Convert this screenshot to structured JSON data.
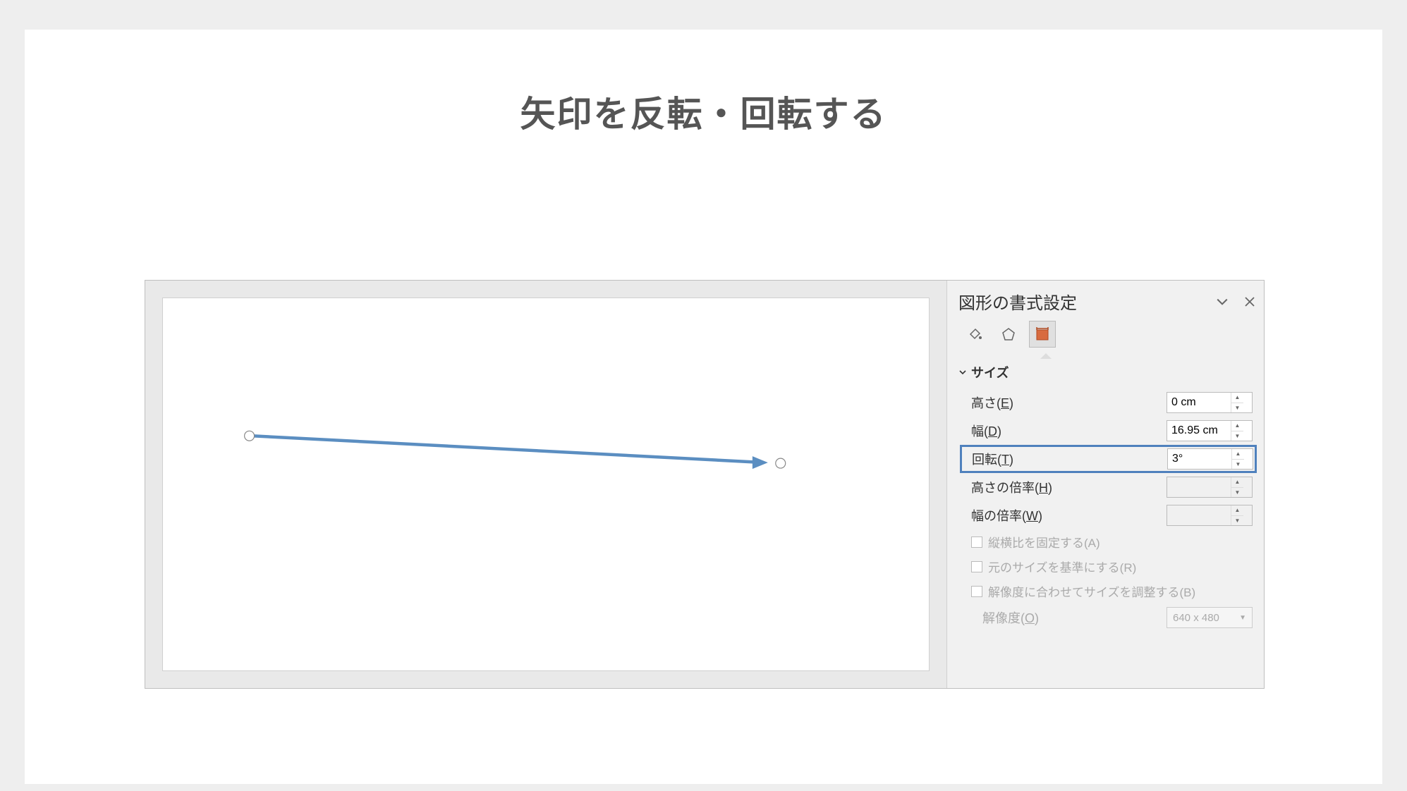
{
  "title": "矢印を反転・回転する",
  "panel": {
    "title": "図形の書式設定",
    "tabs": {
      "fill_icon": "paint-bucket",
      "effects_icon": "pentagon",
      "size_icon": "size-crop"
    },
    "section": "サイズ",
    "fields": {
      "height": {
        "label": "高さ(",
        "key": "E",
        "suffix": ")",
        "value": "0 cm"
      },
      "width": {
        "label": "幅(",
        "key": "D",
        "suffix": ")",
        "value": "16.95 cm"
      },
      "rotation": {
        "label": "回転(",
        "key": "T",
        "suffix": ")",
        "value": "3°"
      },
      "scale_h": {
        "label": "高さの倍率(",
        "key": "H",
        "suffix": ")",
        "value": ""
      },
      "scale_w": {
        "label": "幅の倍率(",
        "key": "W",
        "suffix": ")",
        "value": ""
      }
    },
    "checks": {
      "lock_aspect": {
        "label": "縦横比を固定する(",
        "key": "A",
        "suffix": ")"
      },
      "rel_original": {
        "label": "元のサイズを基準にする(",
        "key": "R",
        "suffix": ")"
      },
      "best_scale": {
        "label": "解像度に合わせてサイズを調整する(",
        "key": "B",
        "suffix": ")"
      }
    },
    "resolution": {
      "label": "解像度(",
      "key": "O",
      "suffix": ")",
      "value": "640 x 480"
    }
  }
}
